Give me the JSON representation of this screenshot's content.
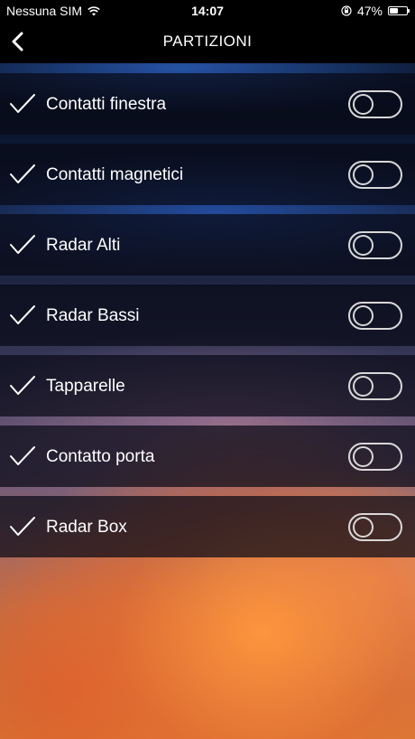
{
  "status_bar": {
    "carrier": "Nessuna SIM",
    "time": "14:07",
    "battery_percent": "47%",
    "battery_level": 0.47
  },
  "header": {
    "title": "PARTIZIONI",
    "back_icon": "chevron-left-icon"
  },
  "partitions": [
    {
      "label": "Contatti finestra",
      "checked": true,
      "enabled": false
    },
    {
      "label": "Contatti magnetici",
      "checked": true,
      "enabled": false
    },
    {
      "label": "Radar Alti",
      "checked": true,
      "enabled": false
    },
    {
      "label": "Radar Bassi",
      "checked": true,
      "enabled": false
    },
    {
      "label": "Tapparelle",
      "checked": true,
      "enabled": false
    },
    {
      "label": "Contatto porta",
      "checked": true,
      "enabled": false
    },
    {
      "label": "Radar Box",
      "checked": true,
      "enabled": false
    }
  ],
  "colors": {
    "text": "#ffffff",
    "bar_background": "#000000",
    "toggle_outline": "#d8d8d8"
  }
}
